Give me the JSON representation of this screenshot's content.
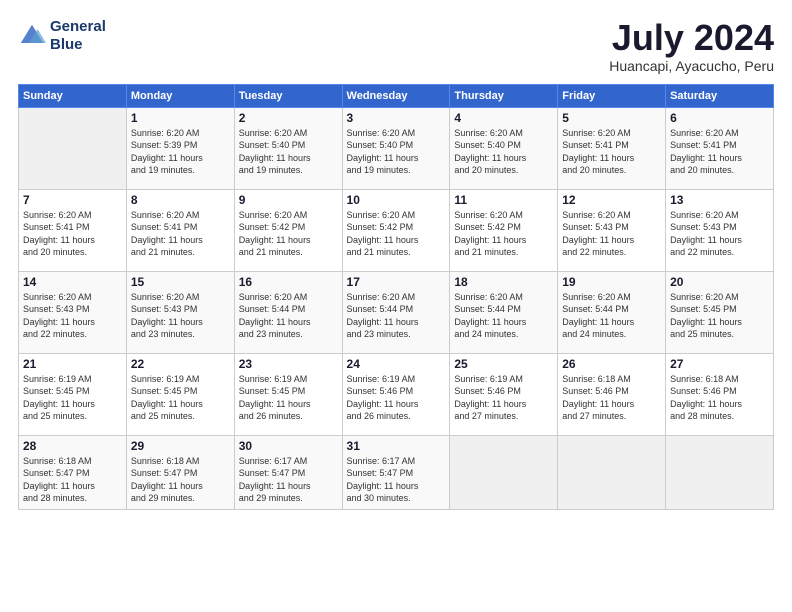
{
  "header": {
    "logo_line1": "General",
    "logo_line2": "Blue",
    "month_title": "July 2024",
    "location": "Huancapi, Ayacucho, Peru"
  },
  "weekdays": [
    "Sunday",
    "Monday",
    "Tuesday",
    "Wednesday",
    "Thursday",
    "Friday",
    "Saturday"
  ],
  "weeks": [
    [
      {
        "day": "",
        "info": ""
      },
      {
        "day": "1",
        "info": "Sunrise: 6:20 AM\nSunset: 5:39 PM\nDaylight: 11 hours\nand 19 minutes."
      },
      {
        "day": "2",
        "info": "Sunrise: 6:20 AM\nSunset: 5:40 PM\nDaylight: 11 hours\nand 19 minutes."
      },
      {
        "day": "3",
        "info": "Sunrise: 6:20 AM\nSunset: 5:40 PM\nDaylight: 11 hours\nand 19 minutes."
      },
      {
        "day": "4",
        "info": "Sunrise: 6:20 AM\nSunset: 5:40 PM\nDaylight: 11 hours\nand 20 minutes."
      },
      {
        "day": "5",
        "info": "Sunrise: 6:20 AM\nSunset: 5:41 PM\nDaylight: 11 hours\nand 20 minutes."
      },
      {
        "day": "6",
        "info": "Sunrise: 6:20 AM\nSunset: 5:41 PM\nDaylight: 11 hours\nand 20 minutes."
      }
    ],
    [
      {
        "day": "7",
        "info": "Sunrise: 6:20 AM\nSunset: 5:41 PM\nDaylight: 11 hours\nand 20 minutes."
      },
      {
        "day": "8",
        "info": "Sunrise: 6:20 AM\nSunset: 5:41 PM\nDaylight: 11 hours\nand 21 minutes."
      },
      {
        "day": "9",
        "info": "Sunrise: 6:20 AM\nSunset: 5:42 PM\nDaylight: 11 hours\nand 21 minutes."
      },
      {
        "day": "10",
        "info": "Sunrise: 6:20 AM\nSunset: 5:42 PM\nDaylight: 11 hours\nand 21 minutes."
      },
      {
        "day": "11",
        "info": "Sunrise: 6:20 AM\nSunset: 5:42 PM\nDaylight: 11 hours\nand 21 minutes."
      },
      {
        "day": "12",
        "info": "Sunrise: 6:20 AM\nSunset: 5:43 PM\nDaylight: 11 hours\nand 22 minutes."
      },
      {
        "day": "13",
        "info": "Sunrise: 6:20 AM\nSunset: 5:43 PM\nDaylight: 11 hours\nand 22 minutes."
      }
    ],
    [
      {
        "day": "14",
        "info": "Sunrise: 6:20 AM\nSunset: 5:43 PM\nDaylight: 11 hours\nand 22 minutes."
      },
      {
        "day": "15",
        "info": "Sunrise: 6:20 AM\nSunset: 5:43 PM\nDaylight: 11 hours\nand 23 minutes."
      },
      {
        "day": "16",
        "info": "Sunrise: 6:20 AM\nSunset: 5:44 PM\nDaylight: 11 hours\nand 23 minutes."
      },
      {
        "day": "17",
        "info": "Sunrise: 6:20 AM\nSunset: 5:44 PM\nDaylight: 11 hours\nand 23 minutes."
      },
      {
        "day": "18",
        "info": "Sunrise: 6:20 AM\nSunset: 5:44 PM\nDaylight: 11 hours\nand 24 minutes."
      },
      {
        "day": "19",
        "info": "Sunrise: 6:20 AM\nSunset: 5:44 PM\nDaylight: 11 hours\nand 24 minutes."
      },
      {
        "day": "20",
        "info": "Sunrise: 6:20 AM\nSunset: 5:45 PM\nDaylight: 11 hours\nand 25 minutes."
      }
    ],
    [
      {
        "day": "21",
        "info": "Sunrise: 6:19 AM\nSunset: 5:45 PM\nDaylight: 11 hours\nand 25 minutes."
      },
      {
        "day": "22",
        "info": "Sunrise: 6:19 AM\nSunset: 5:45 PM\nDaylight: 11 hours\nand 25 minutes."
      },
      {
        "day": "23",
        "info": "Sunrise: 6:19 AM\nSunset: 5:45 PM\nDaylight: 11 hours\nand 26 minutes."
      },
      {
        "day": "24",
        "info": "Sunrise: 6:19 AM\nSunset: 5:46 PM\nDaylight: 11 hours\nand 26 minutes."
      },
      {
        "day": "25",
        "info": "Sunrise: 6:19 AM\nSunset: 5:46 PM\nDaylight: 11 hours\nand 27 minutes."
      },
      {
        "day": "26",
        "info": "Sunrise: 6:18 AM\nSunset: 5:46 PM\nDaylight: 11 hours\nand 27 minutes."
      },
      {
        "day": "27",
        "info": "Sunrise: 6:18 AM\nSunset: 5:46 PM\nDaylight: 11 hours\nand 28 minutes."
      }
    ],
    [
      {
        "day": "28",
        "info": "Sunrise: 6:18 AM\nSunset: 5:47 PM\nDaylight: 11 hours\nand 28 minutes."
      },
      {
        "day": "29",
        "info": "Sunrise: 6:18 AM\nSunset: 5:47 PM\nDaylight: 11 hours\nand 29 minutes."
      },
      {
        "day": "30",
        "info": "Sunrise: 6:17 AM\nSunset: 5:47 PM\nDaylight: 11 hours\nand 29 minutes."
      },
      {
        "day": "31",
        "info": "Sunrise: 6:17 AM\nSunset: 5:47 PM\nDaylight: 11 hours\nand 30 minutes."
      },
      {
        "day": "",
        "info": ""
      },
      {
        "day": "",
        "info": ""
      },
      {
        "day": "",
        "info": ""
      }
    ]
  ]
}
